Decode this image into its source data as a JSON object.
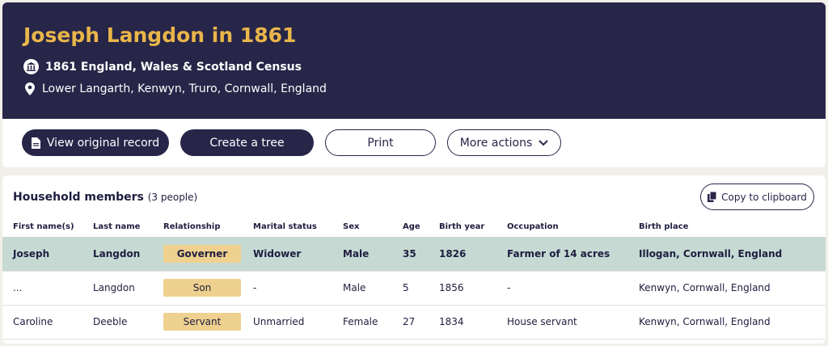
{
  "header": {
    "title": "Joseph Langdon in 1861",
    "collection": "1861 England, Wales & Scotland Census",
    "location": "Lower Langarth, Kenwyn, Truro, Cornwall, England"
  },
  "actions": {
    "view_original": "View original record",
    "create_tree": "Create a tree",
    "print": "Print",
    "more_actions": "More actions"
  },
  "household": {
    "title": "Household members",
    "count": "(3 people)",
    "copy_label": "Copy to clipboard",
    "columns": [
      "First name(s)",
      "Last name",
      "Relationship",
      "Marital status",
      "Sex",
      "Age",
      "Birth year",
      "Occupation",
      "Birth place"
    ],
    "rows": [
      {
        "first": "Joseph",
        "last": "Langdon",
        "relationship": "Governer",
        "marital": "Widower",
        "sex": "Male",
        "age": "35",
        "birth_year": "1826",
        "occupation": "Farmer of 14 acres",
        "birth_place": "Illogan, Cornwall, England"
      },
      {
        "first": "...",
        "last": "Langdon",
        "relationship": "Son",
        "marital": "-",
        "sex": "Male",
        "age": "5",
        "birth_year": "1856",
        "occupation": "-",
        "birth_place": "Kenwyn, Cornwall, England"
      },
      {
        "first": "Caroline",
        "last": "Deeble",
        "relationship": "Servant",
        "marital": "Unmarried",
        "sex": "Female",
        "age": "27",
        "birth_year": "1834",
        "occupation": "House servant",
        "birth_place": "Kenwyn, Cornwall, England"
      }
    ]
  },
  "colors": {
    "navy": "#272548",
    "gold": "#e9b64a",
    "highlight_row": "#c6dad3",
    "relationship_badge": "#efd18f"
  }
}
